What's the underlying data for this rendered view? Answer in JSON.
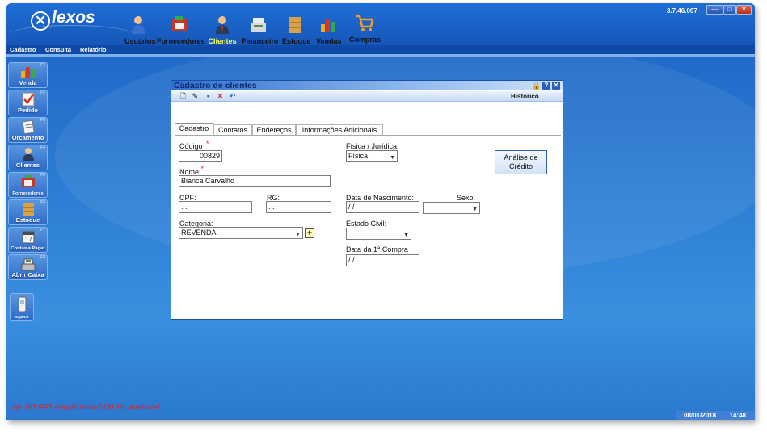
{
  "app": {
    "logo_text": "lexos",
    "version": "3.7.46.007",
    "window_buttons": {
      "minimize": "—",
      "maximize": "□",
      "close": "✕"
    }
  },
  "modules": [
    {
      "label": "Usuários",
      "icon": "users-icon",
      "active": false
    },
    {
      "label": "Fornecedores",
      "icon": "suppliers-icon",
      "active": false
    },
    {
      "label": "Clientes",
      "icon": "clients-icon",
      "active": true
    },
    {
      "label": "Financeiro",
      "icon": "finance-icon",
      "active": false
    },
    {
      "label": "Estoque",
      "icon": "stock-icon",
      "active": false
    },
    {
      "label": "Vendas",
      "icon": "sales-icon",
      "active": false
    },
    {
      "label": "Compras",
      "icon": "cart-icon",
      "active": false
    }
  ],
  "menu": [
    "Cadastro",
    "Consulta",
    "Relatório"
  ],
  "sidebar": [
    {
      "label": "Venda",
      "key": "F1",
      "icon": "sales-icon"
    },
    {
      "label": "Pedido",
      "key": "F2",
      "icon": "order-icon"
    },
    {
      "label": "Orçamento",
      "key": "F3",
      "icon": "quote-icon"
    },
    {
      "label": "Clientes",
      "key": "F4",
      "icon": "clients-icon"
    },
    {
      "label": "Fornecedores",
      "key": "F5",
      "icon": "suppliers-icon"
    },
    {
      "label": "Estoque",
      "key": "F6",
      "icon": "stock-icon"
    },
    {
      "label": "Contas a Pagar",
      "key": "F7",
      "icon": "calendar-icon"
    },
    {
      "label": "Abrir Caixa",
      "key": "F8",
      "icon": "cash-register-icon"
    }
  ],
  "support": {
    "label": "Suporte",
    "icon": "phone-icon"
  },
  "dialog": {
    "title": "Cadastro de clientes",
    "history_label": "Histórico",
    "tabs": [
      "Cadastro",
      "Contatos",
      "Endereços",
      "Informações Adicionais"
    ],
    "fields": {
      "codigo": {
        "label": "Código",
        "value": "00829"
      },
      "nome": {
        "label": "Nome:",
        "value": "Bianca Carvalho"
      },
      "cpf": {
        "label": "CPF:",
        "value": " .   .   -"
      },
      "rg": {
        "label": "RG:",
        "value": " .   .   -"
      },
      "categoria": {
        "label": "Categoria:",
        "value": "REVENDA"
      },
      "tipo": {
        "label": "Física / Jurídica:",
        "value": "Física"
      },
      "nascimento": {
        "label": "Data de Nascimento:",
        "value": " /  /"
      },
      "sexo": {
        "label": "Sexo:",
        "value": ""
      },
      "estado_civil": {
        "label": "Estado Civil:",
        "value": ""
      },
      "primeira_compra": {
        "label": "Data da 1ª Compra",
        "value": " /  /"
      }
    },
    "credit_button": "Análise de\nCrédito",
    "add_category_button": "+"
  },
  "status": {
    "message": "Loja: ROUPAS   Atenção tabela NCM não atualizada!",
    "date": "08/01/2018",
    "time": "14:48"
  },
  "colors": {
    "accent": "#1656b8",
    "active_module": "#ffff66",
    "warning": "#e02020"
  }
}
